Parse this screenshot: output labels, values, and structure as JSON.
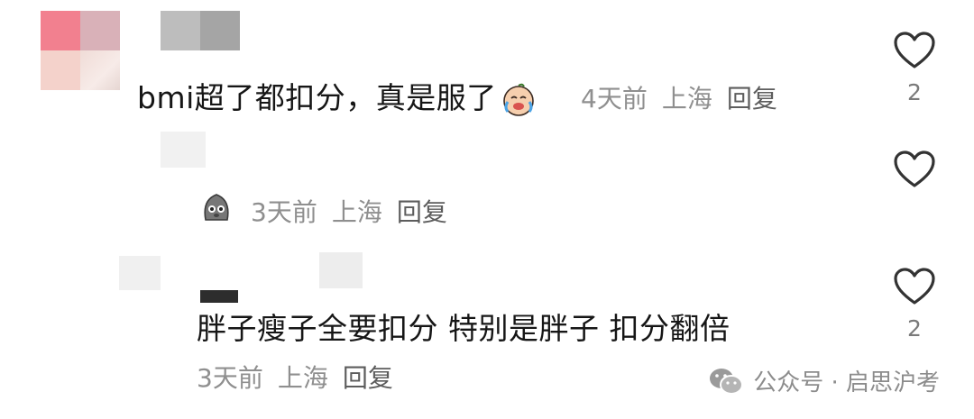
{
  "comments": [
    {
      "text": "bmi超了都扣分，真是服了",
      "emoji_icon": "crying-laughing-face",
      "time": "4天前",
      "location": "上海",
      "reply_label": "回复",
      "likes": "2"
    },
    {
      "emoji_icon": "gray-blob-face",
      "time": "3天前",
      "location": "上海",
      "reply_label": "回复",
      "likes": ""
    },
    {
      "text": "胖子瘦子全要扣分 特别是胖子 扣分翻倍",
      "time": "3天前",
      "location": "上海",
      "reply_label": "回复",
      "likes": "2"
    }
  ],
  "watermark": {
    "icon": "wechat-icon",
    "text": "公众号 · 启思沪考"
  },
  "colors": {
    "comment_text": "#161616",
    "meta_text": "#8f8f8f",
    "like_outline": "#333333"
  }
}
